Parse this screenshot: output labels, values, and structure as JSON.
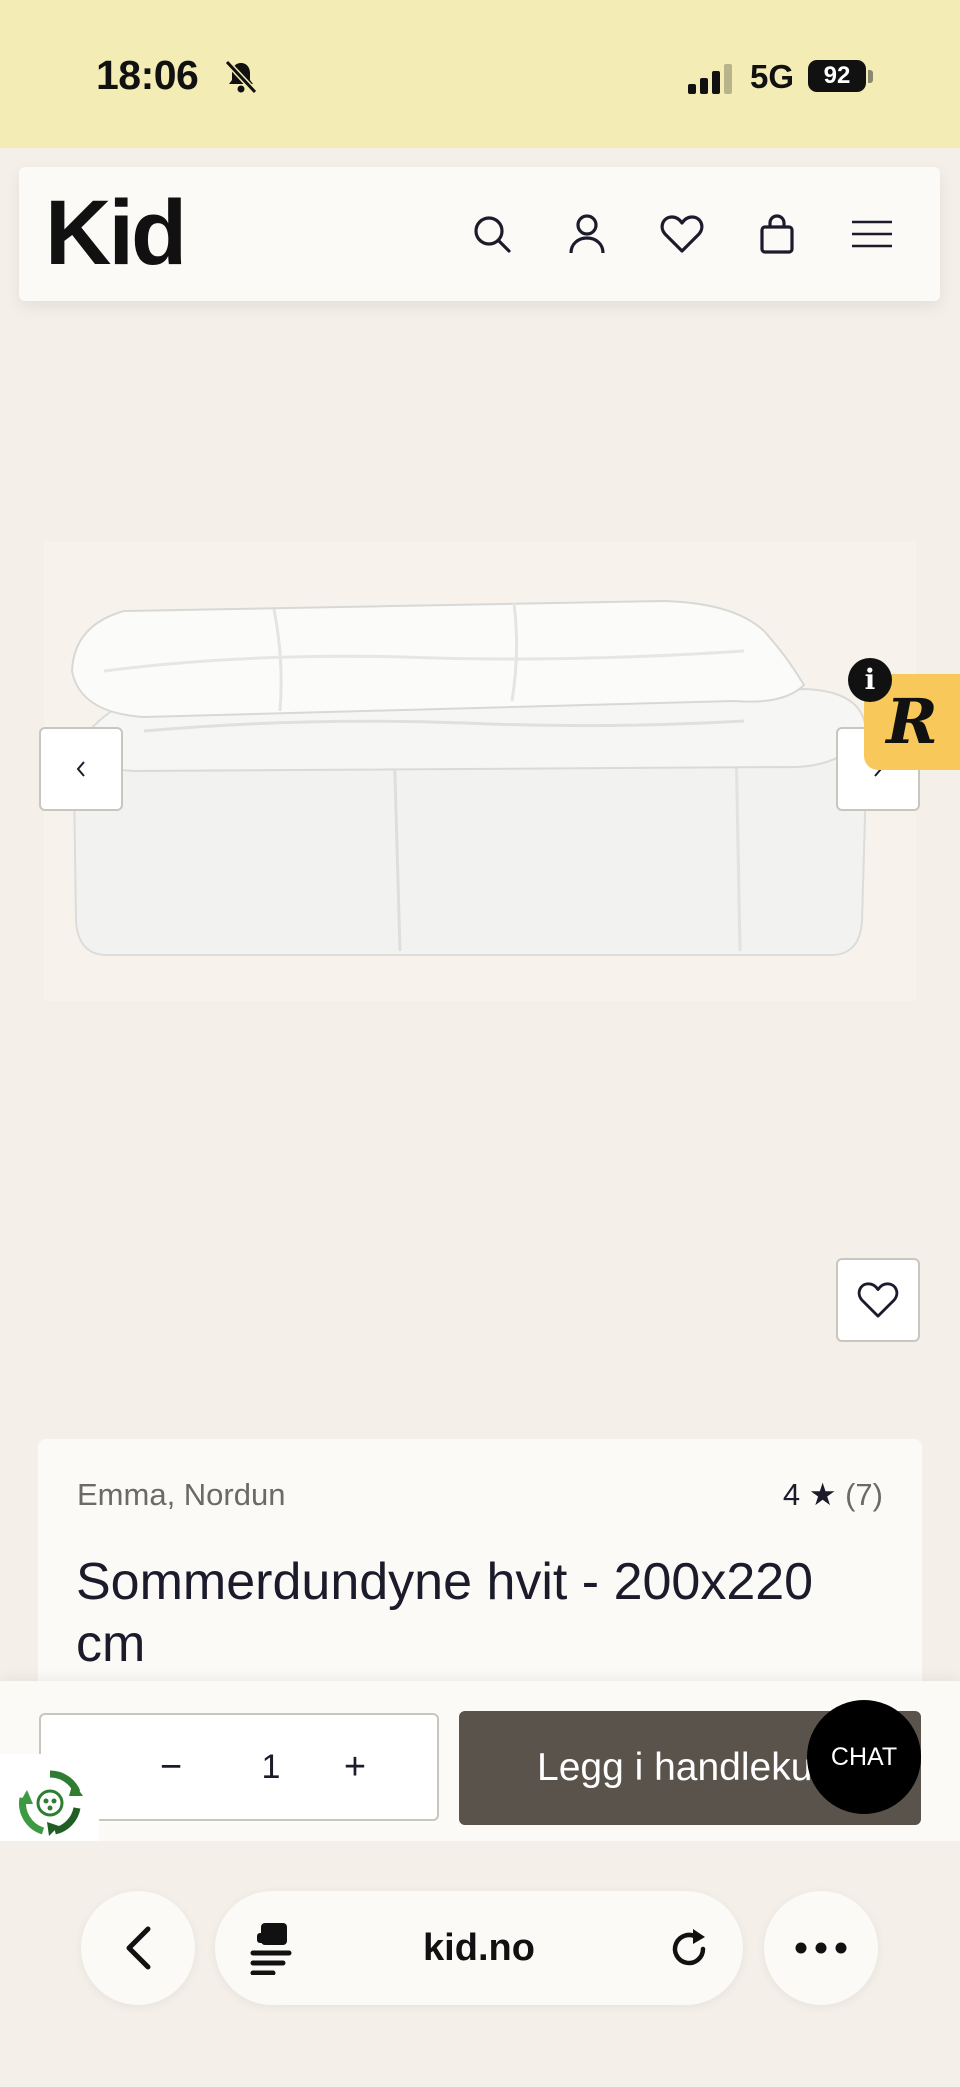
{
  "status_bar": {
    "time": "18:06",
    "network": "5G",
    "battery": "92"
  },
  "header": {
    "logo": "Kid",
    "icons": [
      "search-icon",
      "account-icon",
      "heart-icon",
      "shopping-bag-icon",
      "menu-icon"
    ]
  },
  "gallery": {
    "image_alt": "Sommerdundyne hvit",
    "prev_label": "‹",
    "next_label": "›"
  },
  "widget": {
    "info": "i",
    "letter": "R"
  },
  "product": {
    "brand": "Emma, Nordun",
    "rating_value": "4",
    "rating_star": "★",
    "rating_count": "(7)",
    "title": "Sommerdundyne hvit - 200x220 cm"
  },
  "cart_bar": {
    "qty_minus": "−",
    "quantity": "1",
    "qty_plus": "+",
    "add_label": "Legg i handlekurv",
    "chat_label": "CHAT"
  },
  "browser": {
    "url": "kid.no"
  },
  "colors": {
    "status_bar_bg": "#f3ecb4",
    "page_bg": "#f4f0e9",
    "add_button": "#5a534b",
    "widget": "#f8c95a"
  }
}
